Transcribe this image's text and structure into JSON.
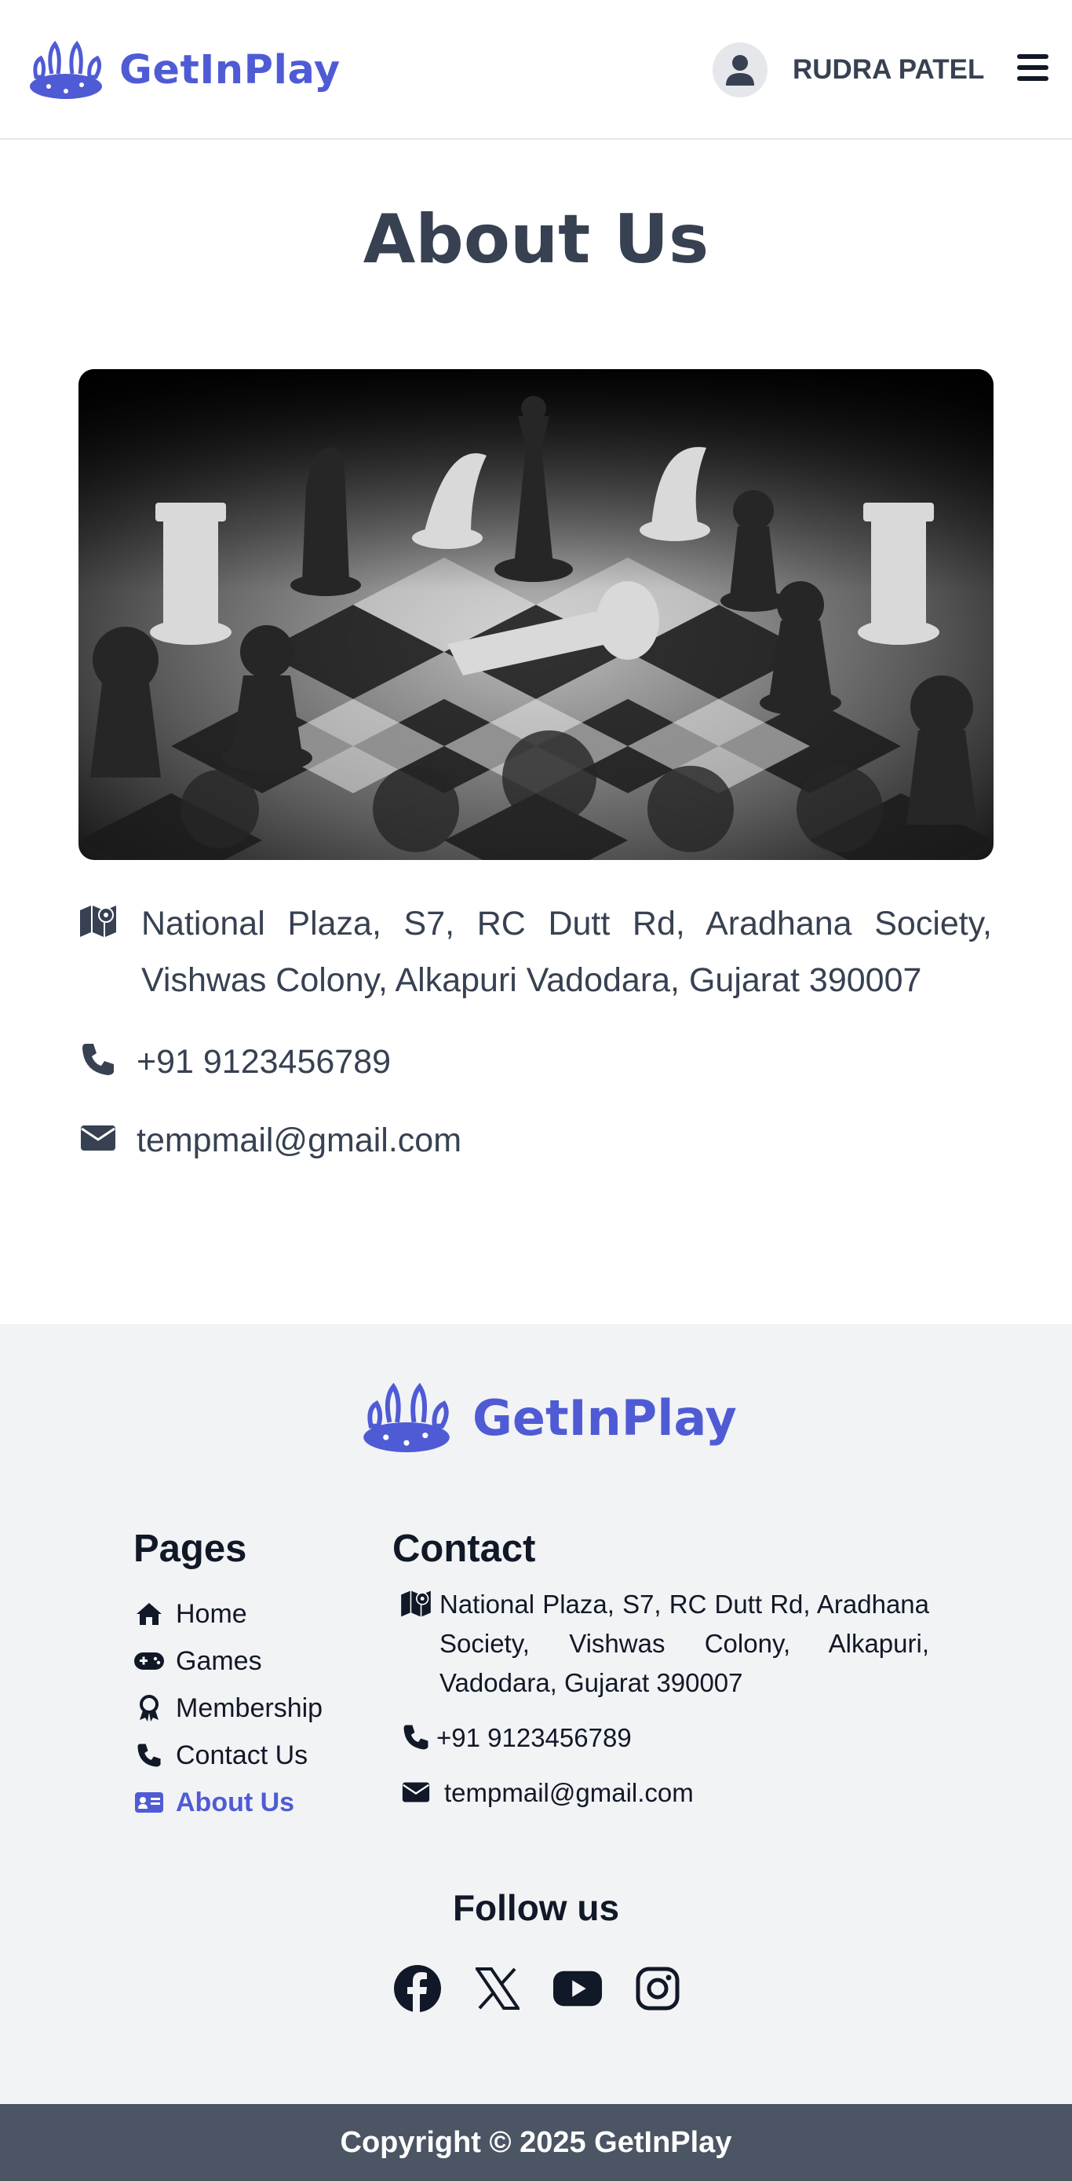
{
  "header": {
    "brand": "GetInPlay",
    "user_name": "RUDRA PATEL",
    "icons": {
      "avatar": "user-icon",
      "menu": "hamburger-icon"
    }
  },
  "main": {
    "title": "About Us",
    "hero_icon": "chess-image",
    "address": "National Plaza, S7, RC Dutt Rd, Aradhana Society, Vishwas Colony, Alkapuri Vadodara, Gujarat 390007",
    "phone": "+91 9123456789",
    "email": "tempmail@gmail.com"
  },
  "footer": {
    "brand": "GetInPlay",
    "pages_title": "Pages",
    "pages": [
      {
        "label": "Home",
        "icon": "home-icon"
      },
      {
        "label": "Games",
        "icon": "gamepad-icon"
      },
      {
        "label": "Membership",
        "icon": "award-icon"
      },
      {
        "label": "Contact Us",
        "icon": "phone-icon"
      },
      {
        "label": "About Us",
        "icon": "id-card-icon",
        "active": true
      }
    ],
    "contact_title": "Contact",
    "address": "National Plaza, S7, RC Dutt Rd, Aradhana Society, Vishwas Colony, Alkapuri, Vadodara, Gujarat 390007",
    "phone": "+91 9123456789",
    "email": "tempmail@gmail.com",
    "follow_title": "Follow us",
    "socials": [
      "facebook-icon",
      "x-icon",
      "youtube-icon",
      "instagram-icon"
    ],
    "copyright": "Copyright © 2025 GetInPlay"
  },
  "colors": {
    "brand": "#4f5bd5",
    "text": "#374151",
    "footer_bg": "#f2f3f5",
    "copyright_bg": "#4b5563"
  }
}
